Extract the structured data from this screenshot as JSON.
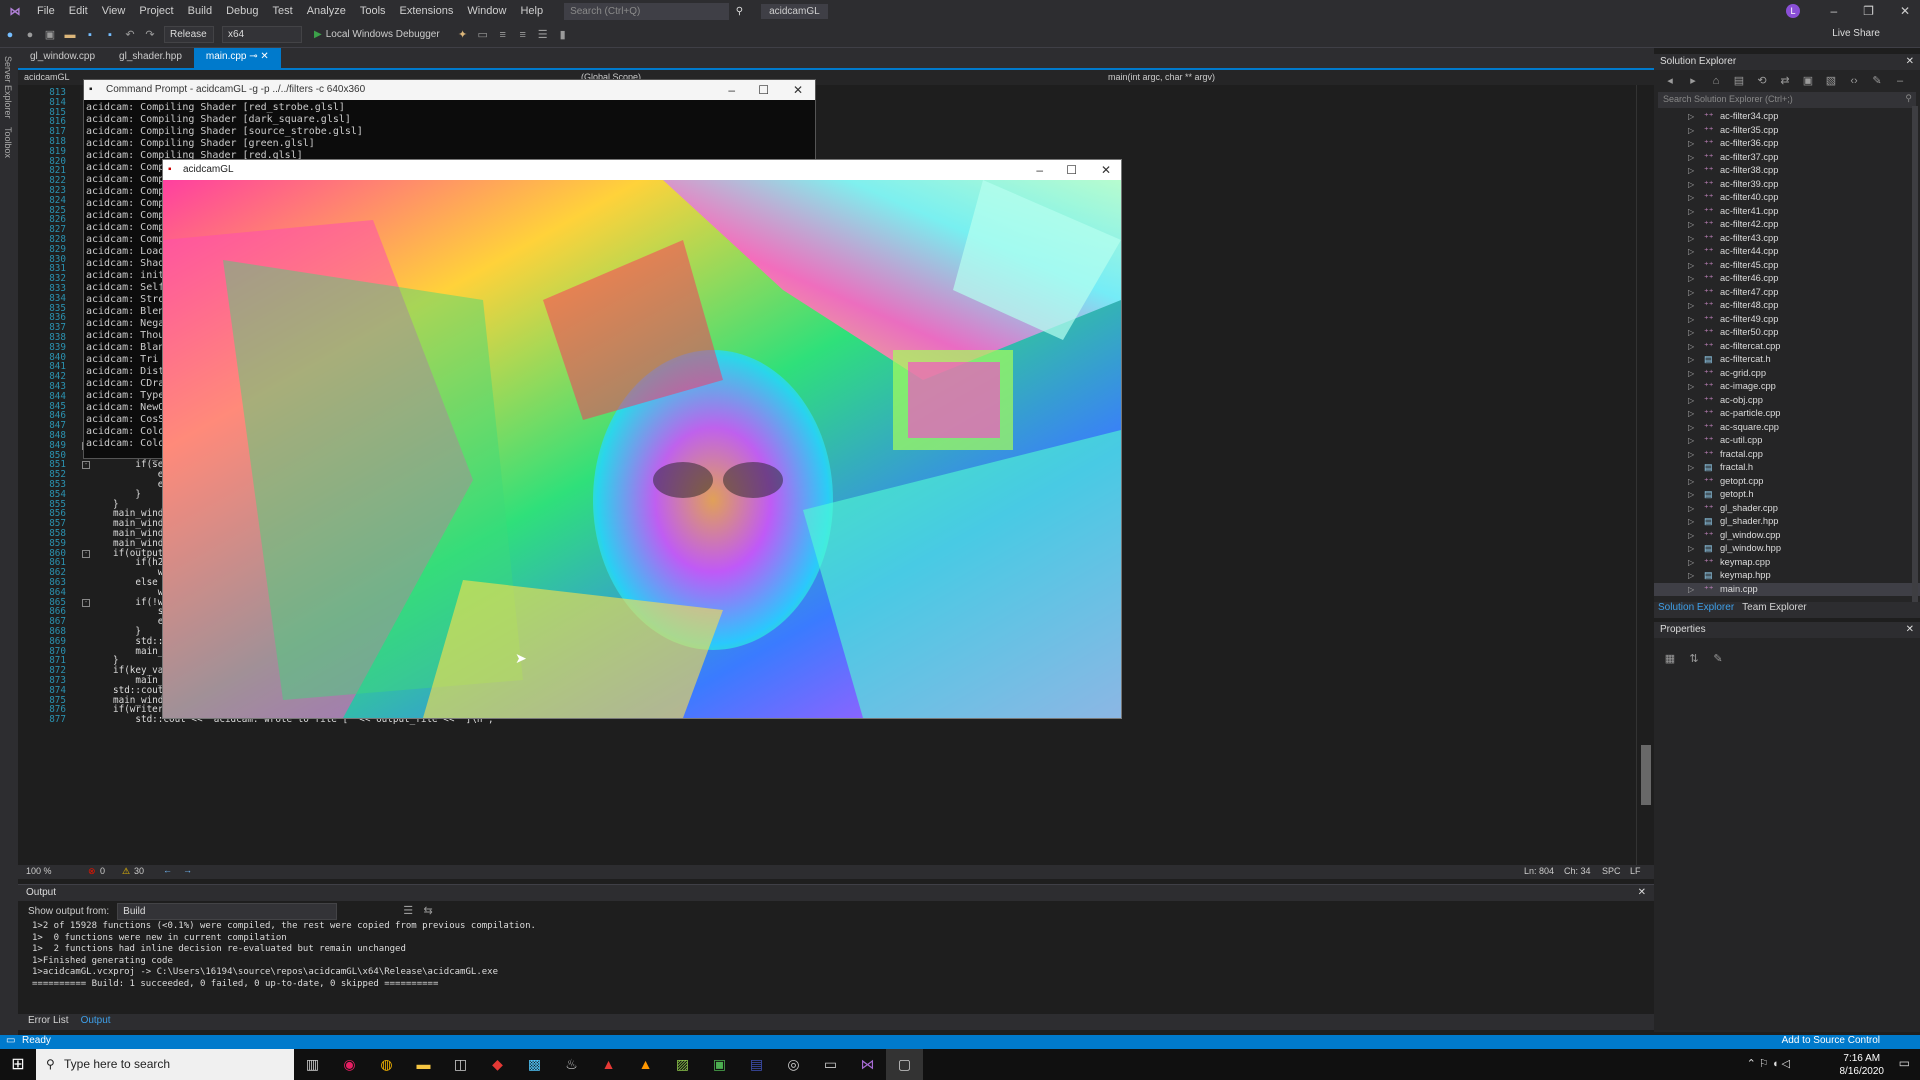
{
  "titlebar": {
    "menu": [
      "File",
      "Edit",
      "View",
      "Project",
      "Build",
      "Debug",
      "Test",
      "Analyze",
      "Tools",
      "Extensions",
      "Window",
      "Help"
    ],
    "search_placeholder": "Search (Ctrl+Q)",
    "solution": "acidcamGL",
    "avatar": "L"
  },
  "toolbar": {
    "config": "Release",
    "platform": "x64",
    "debugger": "Local Windows Debugger",
    "liveshare": "Live Share"
  },
  "leftstrip": [
    "Server Explorer",
    "Toolbox"
  ],
  "tabs": [
    "gl_window.cpp",
    "gl_shader.hpp",
    "main.cpp"
  ],
  "navbar": {
    "project": "acidcamGL",
    "scope": "(Global Scope)",
    "function": "main(int argc, char ** argv)"
  },
  "editor": {
    "lines": [
      {
        "n": "813",
        "t": ""
      },
      {
        "n": "814",
        "t": ""
      },
      {
        "n": "815",
        "t": ""
      },
      {
        "n": "816",
        "t": ""
      },
      {
        "n": "817",
        "t": ""
      },
      {
        "n": "818",
        "t": ""
      },
      {
        "n": "819",
        "t": ""
      },
      {
        "n": "820",
        "t": ""
      },
      {
        "n": "821",
        "t": ""
      },
      {
        "n": "822",
        "t": ""
      },
      {
        "n": "823",
        "t": ""
      },
      {
        "n": "824",
        "t": ""
      },
      {
        "n": "825",
        "t": ""
      },
      {
        "n": "826",
        "t": ""
      },
      {
        "n": "827",
        "t": ""
      },
      {
        "n": "828",
        "t": ""
      },
      {
        "n": "829",
        "t": ""
      },
      {
        "n": "830",
        "t": ""
      },
      {
        "n": "831",
        "t": ""
      },
      {
        "n": "832",
        "t": ""
      },
      {
        "n": "833",
        "t": ""
      },
      {
        "n": "834",
        "t": ""
      },
      {
        "n": "835",
        "t": ""
      },
      {
        "n": "836",
        "t": ""
      },
      {
        "n": "837",
        "t": ""
      },
      {
        "n": "838",
        "t": ""
      },
      {
        "n": "839",
        "t": ""
      },
      {
        "n": "840",
        "t": ""
      },
      {
        "n": "841",
        "t": ""
      },
      {
        "n": "842",
        "t": ""
      },
      {
        "n": "843",
        "t": ""
      },
      {
        "n": "844",
        "t": "    main"
      },
      {
        "n": "845",
        "t": "main_wind"
      },
      {
        "n": "846",
        "t": "main_wind"
      },
      {
        "n": "847",
        "t": "main_wind"
      },
      {
        "n": "848",
        "t": "main_wind"
      },
      {
        "n": "849",
        "t": "if(filter"
      },
      {
        "n": "850",
        "t": "    set_i"
      },
      {
        "n": "851",
        "t": "    if(se"
      },
      {
        "n": "852",
        "t": "        e"
      },
      {
        "n": "853",
        "t": "        e"
      },
      {
        "n": "854",
        "t": "    }"
      },
      {
        "n": "855",
        "t": "}"
      },
      {
        "n": "856",
        "t": "main_wind"
      },
      {
        "n": "857",
        "t": "main_wind"
      },
      {
        "n": "858",
        "t": "main_wind"
      },
      {
        "n": "859",
        "t": "main_wind"
      },
      {
        "n": "860",
        "t": "if(output"
      },
      {
        "n": "861",
        "t": "    if(h2"
      },
      {
        "n": "862",
        "t": "        w"
      },
      {
        "n": "863",
        "t": "    else"
      },
      {
        "n": "864",
        "t": "        w"
      },
      {
        "n": "865",
        "t": "    if(!w"
      },
      {
        "n": "866",
        "t": "        std::cerr << \"acidcam: Error opening video writer...\\n\";"
      },
      {
        "n": "867",
        "t": "        exit(EXIT_FAILURE);"
      },
      {
        "n": "868",
        "t": "    }"
      },
      {
        "n": "869",
        "t": "    std::cout << \"acidcam: record \" << output_file << \" \" << w << \"x\" << h << \" \" << fps << \"\\n\";"
      },
      {
        "n": "870",
        "t": "    main_window.setWriter(writer);"
      },
      {
        "n": "871",
        "t": "}"
      },
      {
        "n": "872",
        "t": "if(key_val.length()>0)"
      },
      {
        "n": "873",
        "t": "    main_window.loadKeys(key_val);"
      },
      {
        "n": "874",
        "t": "std::cout << \"acidcam: initialized...\\n\";"
      },
      {
        "n": "875",
        "t": "main_window.loop();"
      },
      {
        "n": "876",
        "t": "if(writer.isOpened())"
      },
      {
        "n": "877",
        "t": "    std::cout << \"acidcam: wrote to file [\" << output_file << \"]\\n\";"
      }
    ]
  },
  "edstatus": {
    "zoom": "100 %",
    "errors": "0",
    "warnings": "30",
    "ln": "Ln: 804",
    "ch": "Ch: 34",
    "spc": "SPC",
    "lf": "LF"
  },
  "output": {
    "title": "Output",
    "show_from_label": "Show output from:",
    "show_from": "Build",
    "lines": [
      "1>2 of 15928 functions (<0.1%) were compiled, the rest were copied from previous compilation.",
      "1>  0 functions were new in current compilation",
      "1>  2 functions had inline decision re-evaluated but remain unchanged",
      "1>Finished generating code",
      "1>acidcamGL.vcxproj -> C:\\Users\\16194\\source\\repos\\acidcamGL\\x64\\Release\\acidcamGL.exe",
      "========== Build: 1 succeeded, 0 failed, 0 up-to-date, 0 skipped =========="
    ]
  },
  "bottomtabs": [
    "Error List",
    "Output"
  ],
  "solution_explorer": {
    "title": "Solution Explorer",
    "search": "Search Solution Explorer (Ctrl+;)",
    "items": [
      "ac-filter34.cpp",
      "ac-filter35.cpp",
      "ac-filter36.cpp",
      "ac-filter37.cpp",
      "ac-filter38.cpp",
      "ac-filter39.cpp",
      "ac-filter40.cpp",
      "ac-filter41.cpp",
      "ac-filter42.cpp",
      "ac-filter43.cpp",
      "ac-filter44.cpp",
      "ac-filter45.cpp",
      "ac-filter46.cpp",
      "ac-filter47.cpp",
      "ac-filter48.cpp",
      "ac-filter49.cpp",
      "ac-filter50.cpp",
      "ac-filtercat.cpp",
      "ac-filtercat.h",
      "ac-grid.cpp",
      "ac-image.cpp",
      "ac-obj.cpp",
      "ac-particle.cpp",
      "ac-square.cpp",
      "ac-util.cpp",
      "fractal.cpp",
      "fractal.h",
      "getopt.cpp",
      "getopt.h",
      "gl_shader.cpp",
      "gl_shader.hpp",
      "gl_window.cpp",
      "gl_window.hpp",
      "keymap.cpp",
      "keymap.hpp",
      "main.cpp"
    ],
    "tabs": [
      "Solution Explorer",
      "Team Explorer"
    ]
  },
  "properties": {
    "title": "Properties"
  },
  "statusbar": {
    "ready": "Ready",
    "source_control": "Add to Source Control"
  },
  "taskbar": {
    "search": "Type here to search",
    "time": "7:16 AM",
    "date": "8/16/2020"
  },
  "cmd": {
    "title": "Command Prompt - acidcamGL  -g -p ../../filters -c 640x360",
    "lines": [
      "acidcam: Compiling Shader [red_strobe.glsl]",
      "acidcam: Compiling Shader [dark_square.glsl]",
      "acidcam: Compiling Shader [source_strobe.glsl]",
      "acidcam: Compiling Shader [green.glsl]",
      "acidcam: Compiling Shader [red.glsl]",
      "acidcam: Comp",
      "acidcam: Comp",
      "acidcam: Comp",
      "acidcam: Comp",
      "acidcam: Comp",
      "acidcam: Comp",
      "acidcam: Comp",
      "acidcam: Load",
      "acidcam: Shad",
      "acidcam: init",
      "acidcam: Self",
      "acidcam: Stro",
      "acidcam: Blen",
      "acidcam: Nega",
      "acidcam: Thou",
      "acidcam: Blan",
      "acidcam: Tri",
      "acidcam: Dist",
      "acidcam: CDra",
      "acidcam: Type",
      "acidcam: NewO",
      "acidcam: CosS",
      "acidcam: Colo",
      "acidcam: Colo"
    ]
  },
  "acid": {
    "title": "acidcamGL"
  },
  "colors": {
    "accent": "#007acc",
    "bg": "#1e1e1e",
    "panel": "#252526",
    "chrome": "#2d2d30"
  }
}
